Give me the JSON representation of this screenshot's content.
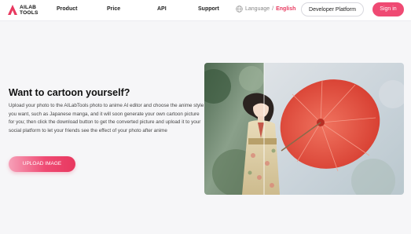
{
  "logo": {
    "line1": "AILAB",
    "line2": "TOOLS"
  },
  "nav": {
    "links": [
      "Product",
      "Price",
      "API",
      "Support"
    ],
    "language_label": "Language",
    "language_separator": "/",
    "language_current": "English",
    "developer_button": "Developer Platform",
    "signin_button": "Sign in"
  },
  "hero": {
    "headline": "Want to cartoon yourself?",
    "description": "Upload your photo to the AILabTools photo to anime AI editor and choose the anime style you want, such as Japanese manga, and it will soon generate your own cartoon picture for you; then click the download button to get the converted picture and upload it to your social platform to let your friends see the effect of your photo after anime",
    "upload_button": "UPLOAD IMAGE"
  },
  "colors": {
    "accent": "#ef4a73",
    "language_active": "#e8385f",
    "page_background": "#f6f6f8"
  }
}
